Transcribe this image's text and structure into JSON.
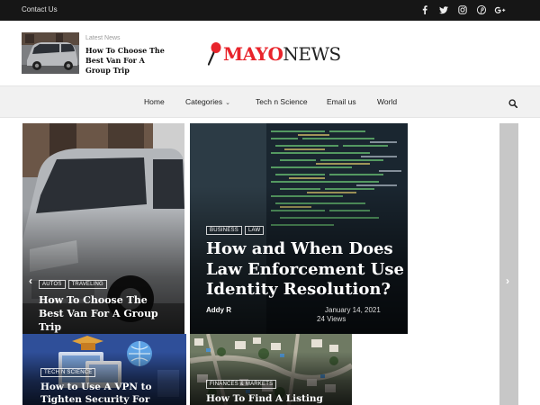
{
  "topbar": {
    "contact_label": "Contact Us",
    "social": [
      {
        "icon": "facebook-icon"
      },
      {
        "icon": "twitter-icon"
      },
      {
        "icon": "instagram-icon"
      },
      {
        "icon": "pinterest-icon"
      },
      {
        "icon": "google-plus-icon"
      }
    ]
  },
  "header": {
    "latest_kicker": "Latest News",
    "latest_headline": "How To Choose The Best Van For A Group Trip",
    "logo_brand": "MAYO",
    "logo_suffix": "NEWS",
    "brand_color": "#e8242b"
  },
  "nav": {
    "items": [
      {
        "label": "Home"
      },
      {
        "label": "Categories"
      },
      {
        "label": "Tech n Science"
      },
      {
        "label": "Email us"
      },
      {
        "label": "World"
      }
    ],
    "search_icon": "search-icon"
  },
  "slider": {
    "prev_arrow": "‹",
    "next_arrow": "›",
    "cards": [
      {
        "tags": [
          "AUTOS",
          "TRAVELING"
        ],
        "title": "How To Choose The Best Van For A Group Trip"
      },
      {
        "tags": [
          "BUSINESS",
          "LAW"
        ],
        "title": "How and When Does Law Enforcement Use Identity Resolution?",
        "author": "Addy R",
        "date": "January 14, 2021",
        "views": "24 Views"
      },
      {
        "tags": [
          "TECH N SCIENCE"
        ],
        "title": "How to Use A VPN to Tighten Security For"
      },
      {
        "tags": [
          "FINANCES & MARKETS"
        ],
        "title": "How To Find A Listing"
      }
    ]
  }
}
